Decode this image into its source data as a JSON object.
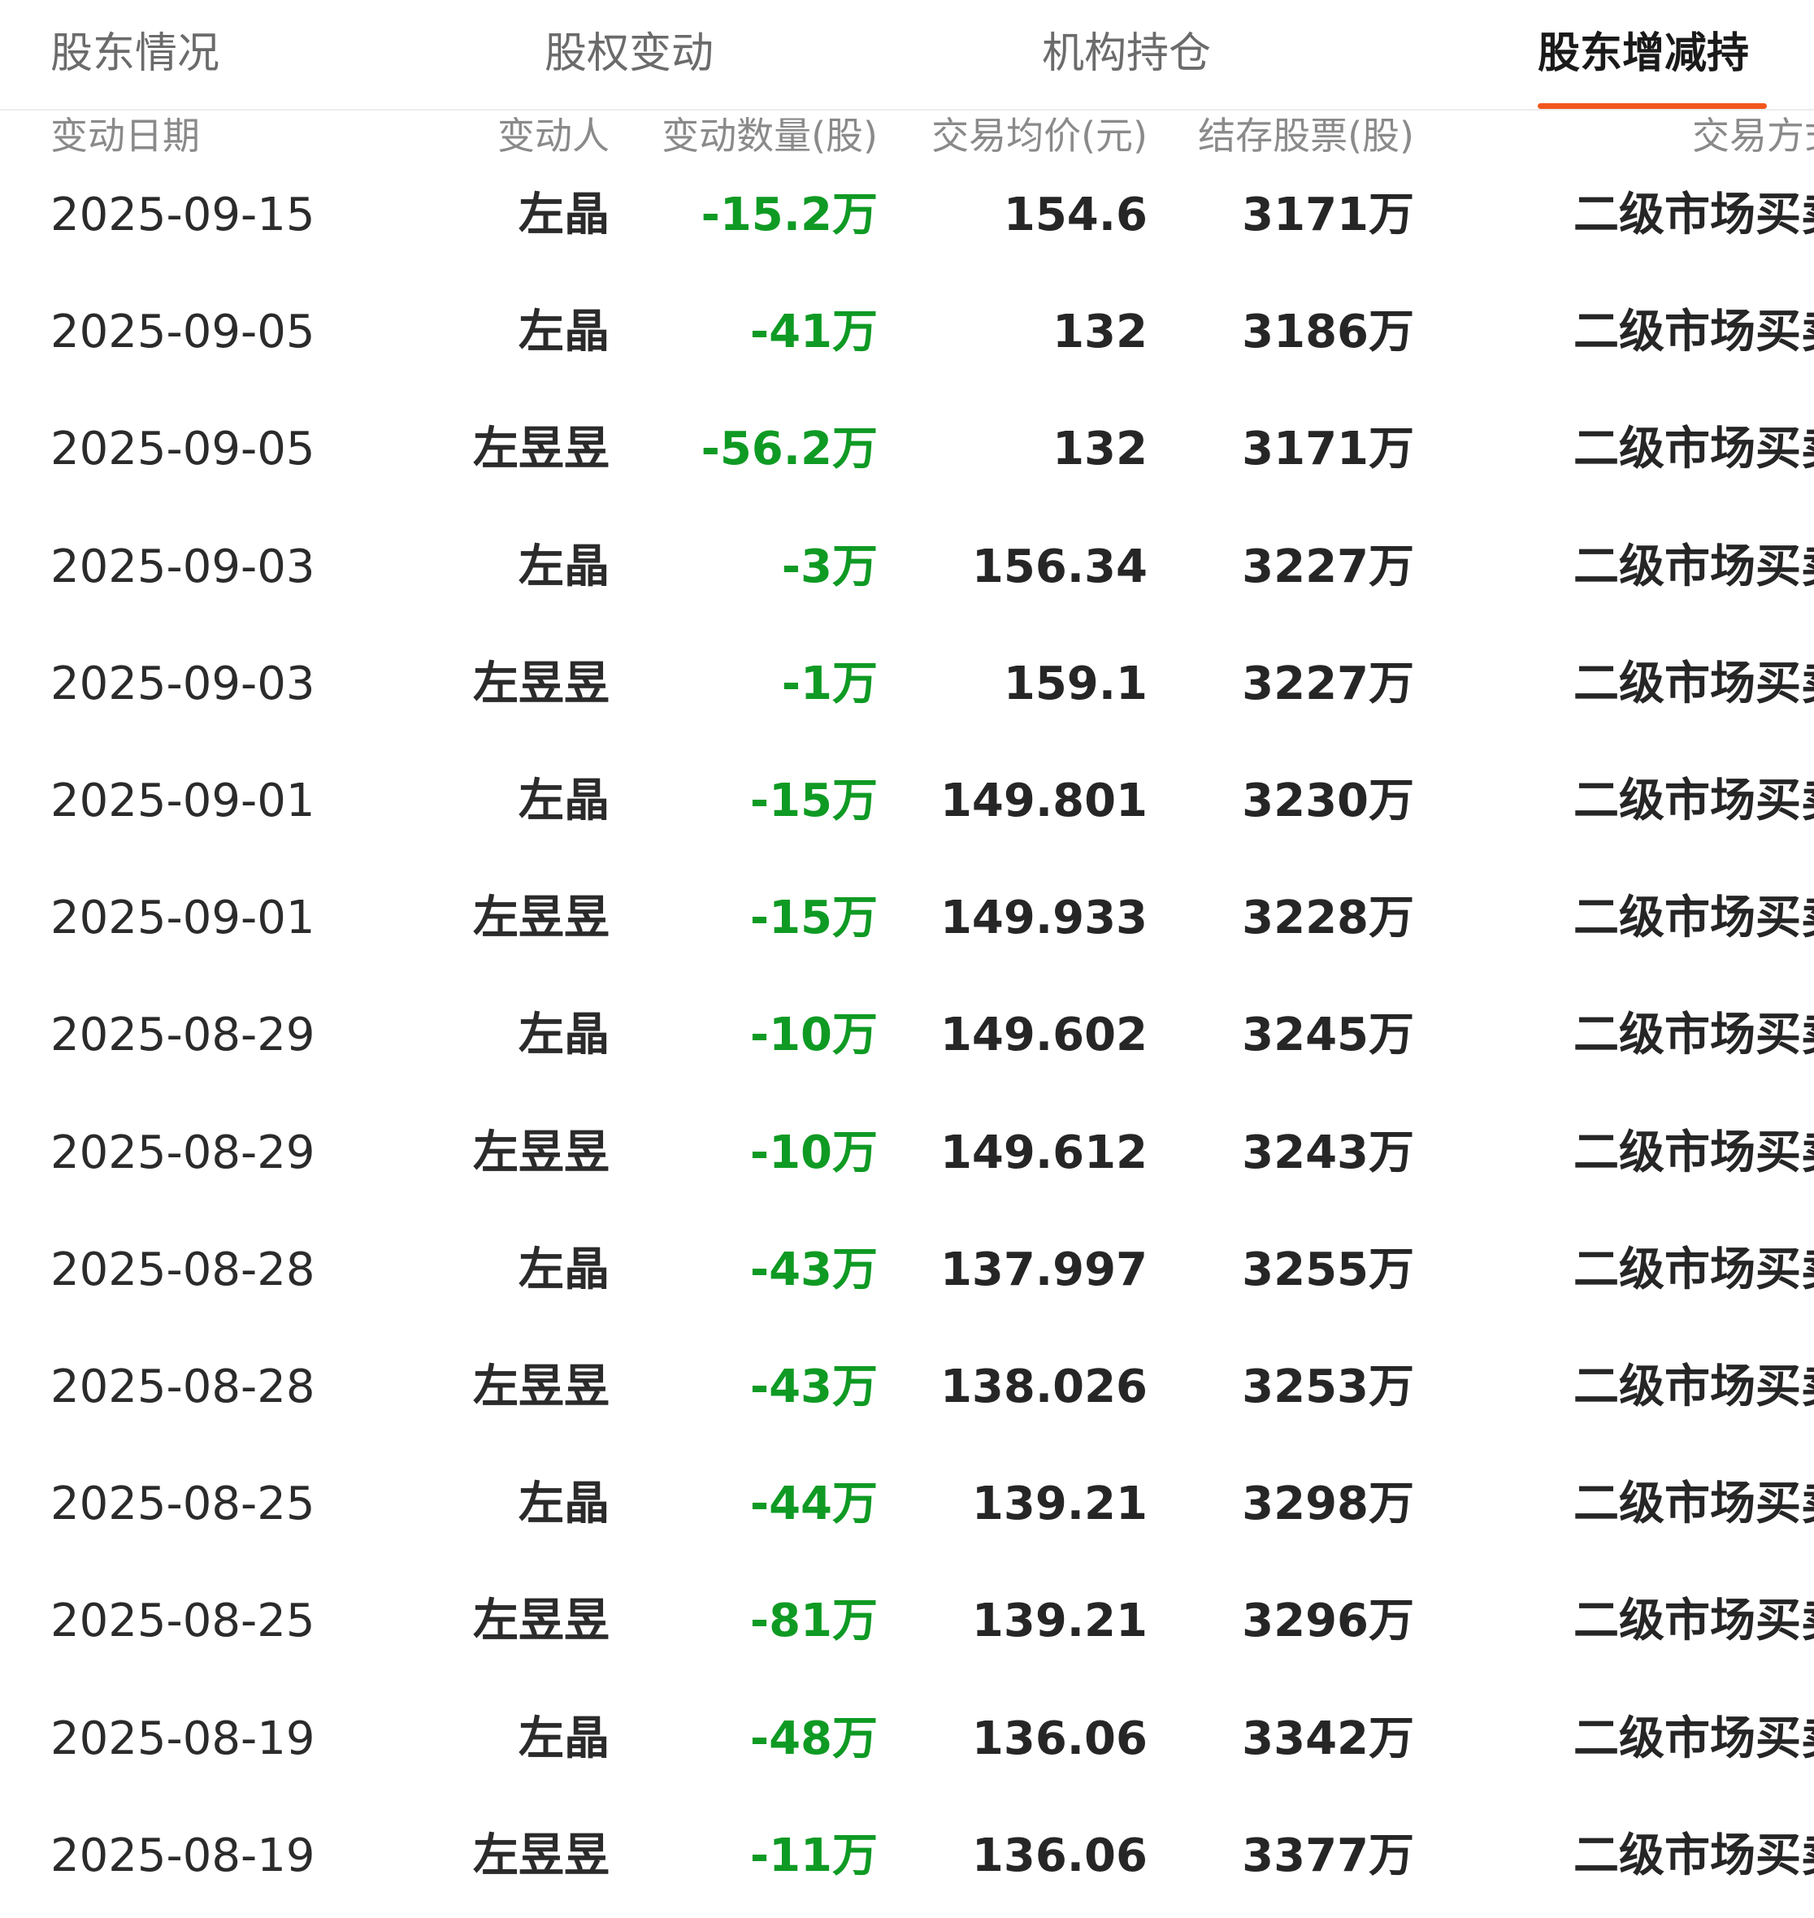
{
  "tabs": [
    {
      "label": "股东情况",
      "active": false
    },
    {
      "label": "股权变动",
      "active": false
    },
    {
      "label": "机构持仓",
      "active": false
    },
    {
      "label": "股东增减持",
      "active": true
    }
  ],
  "colors": {
    "accent": "#f2561d",
    "decrease": "#0f9a24"
  },
  "table": {
    "headers": {
      "date": "变动日期",
      "name": "变动人",
      "change": "变动数量(股)",
      "price": "交易均价(元)",
      "holding": "结存股票(股)",
      "method": "交易方式"
    },
    "rows": [
      {
        "date": "2025-09-15",
        "name": "左晶",
        "change": "-15.2万",
        "price": "154.6",
        "holding": "3171万",
        "method": "二级市场买卖"
      },
      {
        "date": "2025-09-05",
        "name": "左晶",
        "change": "-41万",
        "price": "132",
        "holding": "3186万",
        "method": "二级市场买卖"
      },
      {
        "date": "2025-09-05",
        "name": "左昱昱",
        "change": "-56.2万",
        "price": "132",
        "holding": "3171万",
        "method": "二级市场买卖"
      },
      {
        "date": "2025-09-03",
        "name": "左晶",
        "change": "-3万",
        "price": "156.34",
        "holding": "3227万",
        "method": "二级市场买卖"
      },
      {
        "date": "2025-09-03",
        "name": "左昱昱",
        "change": "-1万",
        "price": "159.1",
        "holding": "3227万",
        "method": "二级市场买卖"
      },
      {
        "date": "2025-09-01",
        "name": "左晶",
        "change": "-15万",
        "price": "149.801",
        "holding": "3230万",
        "method": "二级市场买卖"
      },
      {
        "date": "2025-09-01",
        "name": "左昱昱",
        "change": "-15万",
        "price": "149.933",
        "holding": "3228万",
        "method": "二级市场买卖"
      },
      {
        "date": "2025-08-29",
        "name": "左晶",
        "change": "-10万",
        "price": "149.602",
        "holding": "3245万",
        "method": "二级市场买卖"
      },
      {
        "date": "2025-08-29",
        "name": "左昱昱",
        "change": "-10万",
        "price": "149.612",
        "holding": "3243万",
        "method": "二级市场买卖"
      },
      {
        "date": "2025-08-28",
        "name": "左晶",
        "change": "-43万",
        "price": "137.997",
        "holding": "3255万",
        "method": "二级市场买卖"
      },
      {
        "date": "2025-08-28",
        "name": "左昱昱",
        "change": "-43万",
        "price": "138.026",
        "holding": "3253万",
        "method": "二级市场买卖"
      },
      {
        "date": "2025-08-25",
        "name": "左晶",
        "change": "-44万",
        "price": "139.21",
        "holding": "3298万",
        "method": "二级市场买卖"
      },
      {
        "date": "2025-08-25",
        "name": "左昱昱",
        "change": "-81万",
        "price": "139.21",
        "holding": "3296万",
        "method": "二级市场买卖"
      },
      {
        "date": "2025-08-19",
        "name": "左晶",
        "change": "-48万",
        "price": "136.06",
        "holding": "3342万",
        "method": "二级市场买卖"
      },
      {
        "date": "2025-08-19",
        "name": "左昱昱",
        "change": "-11万",
        "price": "136.06",
        "holding": "3377万",
        "method": "二级市场买卖"
      }
    ]
  }
}
